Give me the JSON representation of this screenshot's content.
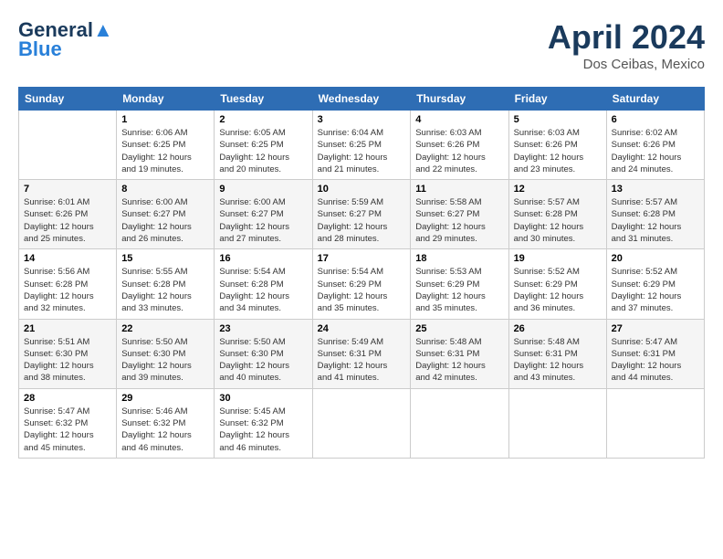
{
  "header": {
    "logo_line1": "General",
    "logo_line2": "Blue",
    "month_title": "April 2024",
    "location": "Dos Ceibas, Mexico"
  },
  "days_of_week": [
    "Sunday",
    "Monday",
    "Tuesday",
    "Wednesday",
    "Thursday",
    "Friday",
    "Saturday"
  ],
  "weeks": [
    [
      {
        "day": "",
        "info": ""
      },
      {
        "day": "1",
        "info": "Sunrise: 6:06 AM\nSunset: 6:25 PM\nDaylight: 12 hours\nand 19 minutes."
      },
      {
        "day": "2",
        "info": "Sunrise: 6:05 AM\nSunset: 6:25 PM\nDaylight: 12 hours\nand 20 minutes."
      },
      {
        "day": "3",
        "info": "Sunrise: 6:04 AM\nSunset: 6:25 PM\nDaylight: 12 hours\nand 21 minutes."
      },
      {
        "day": "4",
        "info": "Sunrise: 6:03 AM\nSunset: 6:26 PM\nDaylight: 12 hours\nand 22 minutes."
      },
      {
        "day": "5",
        "info": "Sunrise: 6:03 AM\nSunset: 6:26 PM\nDaylight: 12 hours\nand 23 minutes."
      },
      {
        "day": "6",
        "info": "Sunrise: 6:02 AM\nSunset: 6:26 PM\nDaylight: 12 hours\nand 24 minutes."
      }
    ],
    [
      {
        "day": "7",
        "info": "Sunrise: 6:01 AM\nSunset: 6:26 PM\nDaylight: 12 hours\nand 25 minutes."
      },
      {
        "day": "8",
        "info": "Sunrise: 6:00 AM\nSunset: 6:27 PM\nDaylight: 12 hours\nand 26 minutes."
      },
      {
        "day": "9",
        "info": "Sunrise: 6:00 AM\nSunset: 6:27 PM\nDaylight: 12 hours\nand 27 minutes."
      },
      {
        "day": "10",
        "info": "Sunrise: 5:59 AM\nSunset: 6:27 PM\nDaylight: 12 hours\nand 28 minutes."
      },
      {
        "day": "11",
        "info": "Sunrise: 5:58 AM\nSunset: 6:27 PM\nDaylight: 12 hours\nand 29 minutes."
      },
      {
        "day": "12",
        "info": "Sunrise: 5:57 AM\nSunset: 6:28 PM\nDaylight: 12 hours\nand 30 minutes."
      },
      {
        "day": "13",
        "info": "Sunrise: 5:57 AM\nSunset: 6:28 PM\nDaylight: 12 hours\nand 31 minutes."
      }
    ],
    [
      {
        "day": "14",
        "info": "Sunrise: 5:56 AM\nSunset: 6:28 PM\nDaylight: 12 hours\nand 32 minutes."
      },
      {
        "day": "15",
        "info": "Sunrise: 5:55 AM\nSunset: 6:28 PM\nDaylight: 12 hours\nand 33 minutes."
      },
      {
        "day": "16",
        "info": "Sunrise: 5:54 AM\nSunset: 6:28 PM\nDaylight: 12 hours\nand 34 minutes."
      },
      {
        "day": "17",
        "info": "Sunrise: 5:54 AM\nSunset: 6:29 PM\nDaylight: 12 hours\nand 35 minutes."
      },
      {
        "day": "18",
        "info": "Sunrise: 5:53 AM\nSunset: 6:29 PM\nDaylight: 12 hours\nand 35 minutes."
      },
      {
        "day": "19",
        "info": "Sunrise: 5:52 AM\nSunset: 6:29 PM\nDaylight: 12 hours\nand 36 minutes."
      },
      {
        "day": "20",
        "info": "Sunrise: 5:52 AM\nSunset: 6:29 PM\nDaylight: 12 hours\nand 37 minutes."
      }
    ],
    [
      {
        "day": "21",
        "info": "Sunrise: 5:51 AM\nSunset: 6:30 PM\nDaylight: 12 hours\nand 38 minutes."
      },
      {
        "day": "22",
        "info": "Sunrise: 5:50 AM\nSunset: 6:30 PM\nDaylight: 12 hours\nand 39 minutes."
      },
      {
        "day": "23",
        "info": "Sunrise: 5:50 AM\nSunset: 6:30 PM\nDaylight: 12 hours\nand 40 minutes."
      },
      {
        "day": "24",
        "info": "Sunrise: 5:49 AM\nSunset: 6:31 PM\nDaylight: 12 hours\nand 41 minutes."
      },
      {
        "day": "25",
        "info": "Sunrise: 5:48 AM\nSunset: 6:31 PM\nDaylight: 12 hours\nand 42 minutes."
      },
      {
        "day": "26",
        "info": "Sunrise: 5:48 AM\nSunset: 6:31 PM\nDaylight: 12 hours\nand 43 minutes."
      },
      {
        "day": "27",
        "info": "Sunrise: 5:47 AM\nSunset: 6:31 PM\nDaylight: 12 hours\nand 44 minutes."
      }
    ],
    [
      {
        "day": "28",
        "info": "Sunrise: 5:47 AM\nSunset: 6:32 PM\nDaylight: 12 hours\nand 45 minutes."
      },
      {
        "day": "29",
        "info": "Sunrise: 5:46 AM\nSunset: 6:32 PM\nDaylight: 12 hours\nand 46 minutes."
      },
      {
        "day": "30",
        "info": "Sunrise: 5:45 AM\nSunset: 6:32 PM\nDaylight: 12 hours\nand 46 minutes."
      },
      {
        "day": "",
        "info": ""
      },
      {
        "day": "",
        "info": ""
      },
      {
        "day": "",
        "info": ""
      },
      {
        "day": "",
        "info": ""
      }
    ]
  ]
}
